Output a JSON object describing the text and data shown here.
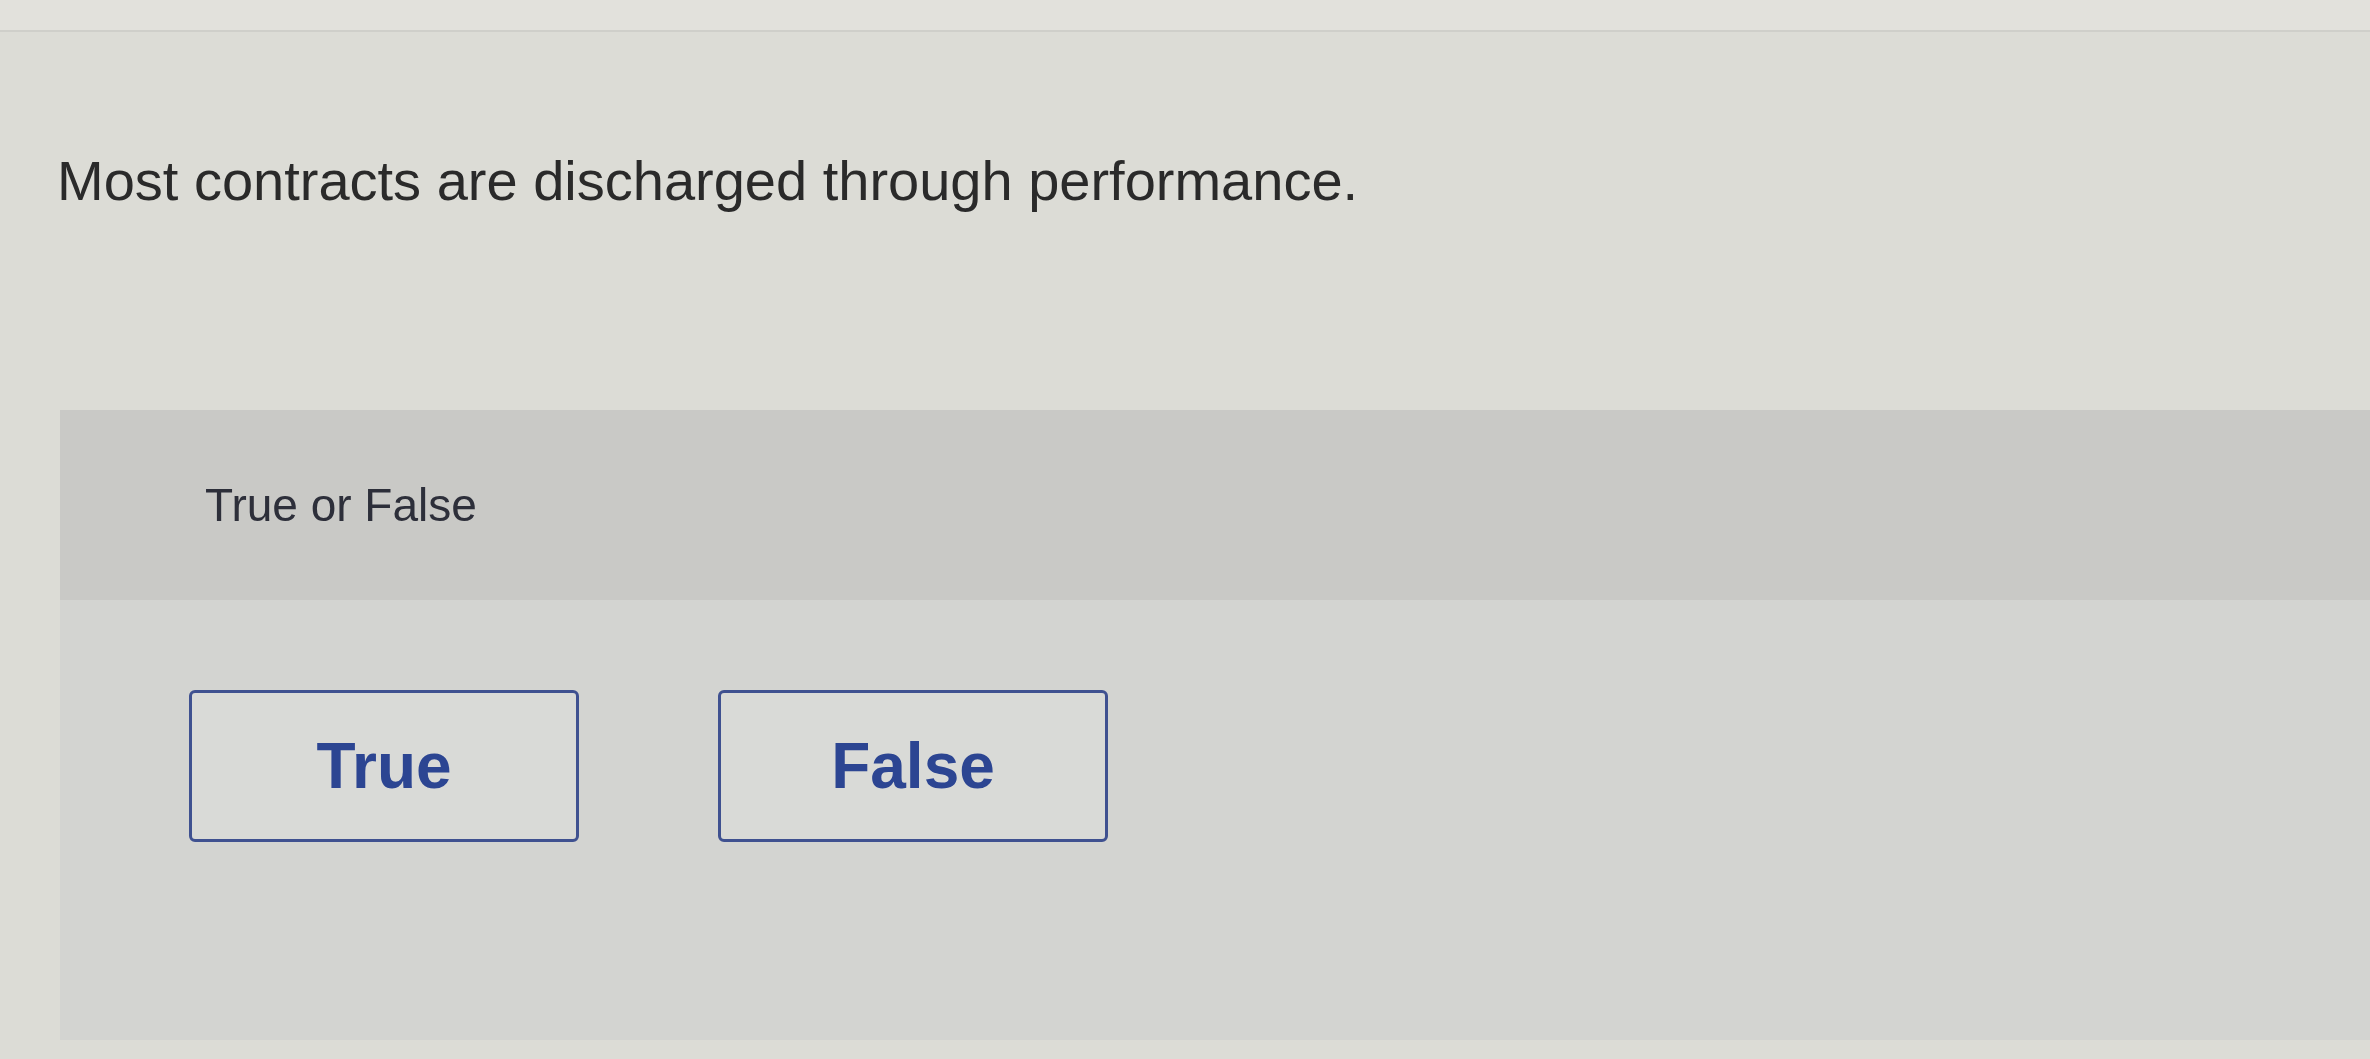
{
  "question": {
    "text": "Most contracts are discharged through performance."
  },
  "answer_panel": {
    "prompt": "True or False",
    "options": [
      {
        "label": "True",
        "selected": false
      },
      {
        "label": "False",
        "selected": false
      }
    ]
  }
}
